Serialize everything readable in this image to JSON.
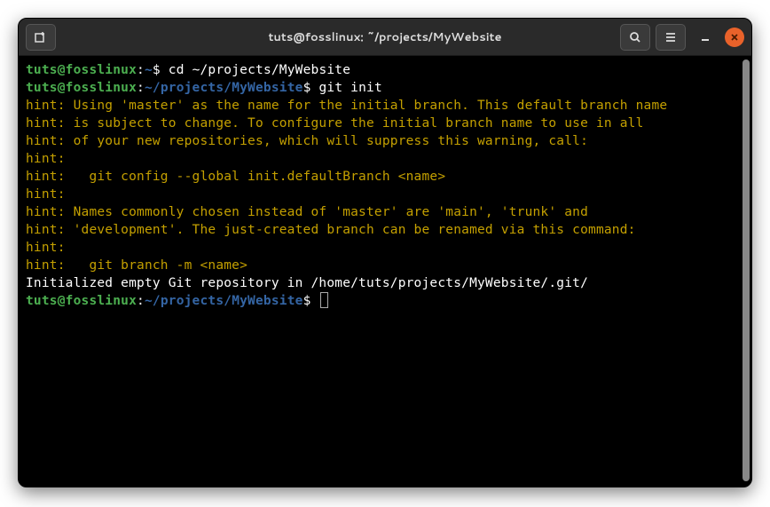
{
  "window": {
    "title": "tuts@fosslinux: ~/projects/MyWebsite"
  },
  "prompts": {
    "user_host": "tuts@fosslinux",
    "colon": ":",
    "home_path": "~",
    "full_path": "~/projects/MyWebsite",
    "dollar": "$ "
  },
  "commands": {
    "cd": "cd ~/projects/MyWebsite",
    "git_init": "git init"
  },
  "hints": {
    "l1": "hint: Using 'master' as the name for the initial branch. This default branch name",
    "l2": "hint: is subject to change. To configure the initial branch name to use in all",
    "l3": "hint: of your new repositories, which will suppress this warning, call:",
    "l4": "hint:",
    "l5": "hint:   git config --global init.defaultBranch <name>",
    "l6": "hint:",
    "l7": "hint: Names commonly chosen instead of 'master' are 'main', 'trunk' and",
    "l8": "hint: 'development'. The just-created branch can be renamed via this command:",
    "l9": "hint:",
    "l10": "hint:   git branch -m <name>"
  },
  "output": {
    "initialized": "Initialized empty Git repository in /home/tuts/projects/MyWebsite/.git/"
  }
}
